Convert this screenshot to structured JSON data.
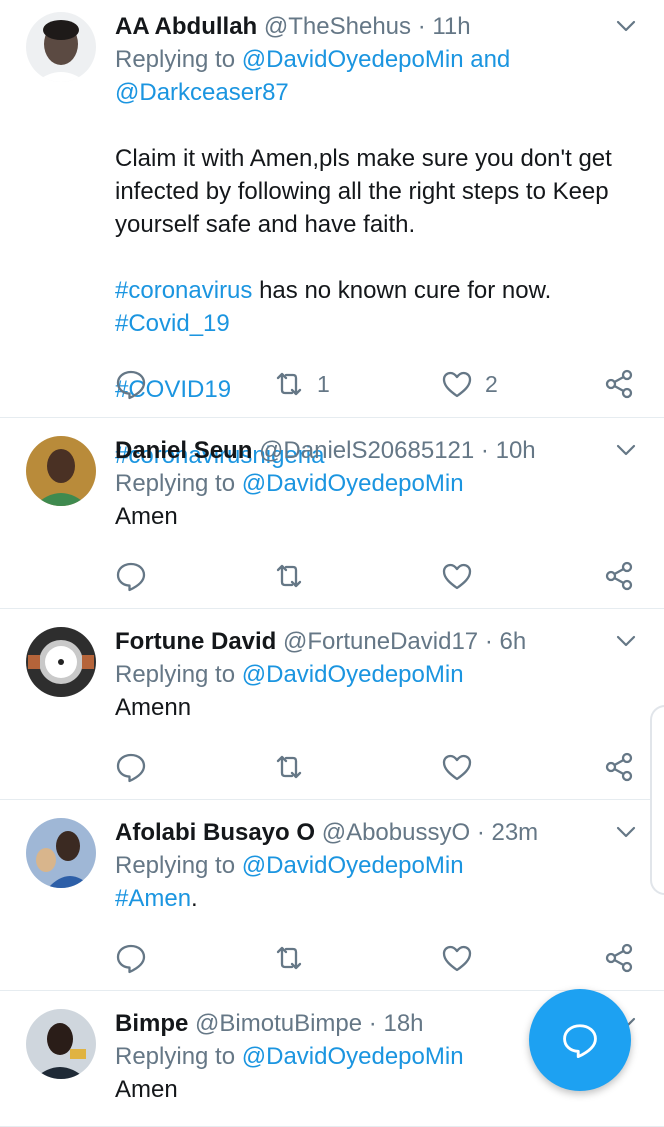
{
  "colors": {
    "accent": "#1b95e0",
    "muted": "#657786",
    "text": "#14171a",
    "fab": "#1da1f2",
    "divider": "#e6ecf0"
  },
  "tweets": [
    {
      "name": "AA Abdullah",
      "handle": "@TheShehus",
      "dot": "·",
      "time": "11h",
      "replying_prefix": "Replying to",
      "mention1": "@DavidOyedepoMin",
      "mention_joiner": "and",
      "mention2": "@Darkceaser87",
      "text": "Claim it with Amen,pls make sure you don't get infected by following all the right steps to Keep yourself safe and have faith.",
      "inline_hashtag": "#coronavirus",
      "inline_rest": " has no known cure for now.",
      "hashtags": [
        "#Covid_19",
        "#COVID19",
        "#coronavirusnigeria"
      ],
      "retweets": "1",
      "likes": "2",
      "avatar_icon": "avatar-photo"
    },
    {
      "name": "Daniel Seun",
      "handle": "@DanielS20685121",
      "dot": "·",
      "time": "10h",
      "replying_prefix": "Replying to",
      "mention1": "@DavidOyedepoMin",
      "text": "Amen",
      "avatar_icon": "avatar-photo"
    },
    {
      "name": "Fortune David",
      "handle": "@FortuneDavid17",
      "dot": "·",
      "time": "6h",
      "replying_prefix": "Replying to",
      "mention1": "@DavidOyedepoMin",
      "text": "Amenn",
      "avatar_icon": "watch-photo"
    },
    {
      "name": "Afolabi Busayo O",
      "handle": "@AbobussyO",
      "dot": "·",
      "time": "23m",
      "replying_prefix": "Replying to",
      "mention1": "@DavidOyedepoMin",
      "text_hashtag": "#Amen",
      "text_after": ".",
      "avatar_icon": "avatar-photo"
    },
    {
      "name": "Bimpe",
      "handle": "@BimotuBimpe",
      "dot": "·",
      "time": "18h",
      "replying_prefix": "Replying to",
      "mention1": "@DavidOyedepoMin",
      "text": "Amen",
      "avatar_icon": "avatar-photo"
    }
  ],
  "icons": {
    "reply": "reply-icon",
    "retweet": "retweet-icon",
    "like": "like-icon",
    "share": "share-icon",
    "caret": "chevron-down-icon",
    "compose": "compose-reply-icon"
  }
}
